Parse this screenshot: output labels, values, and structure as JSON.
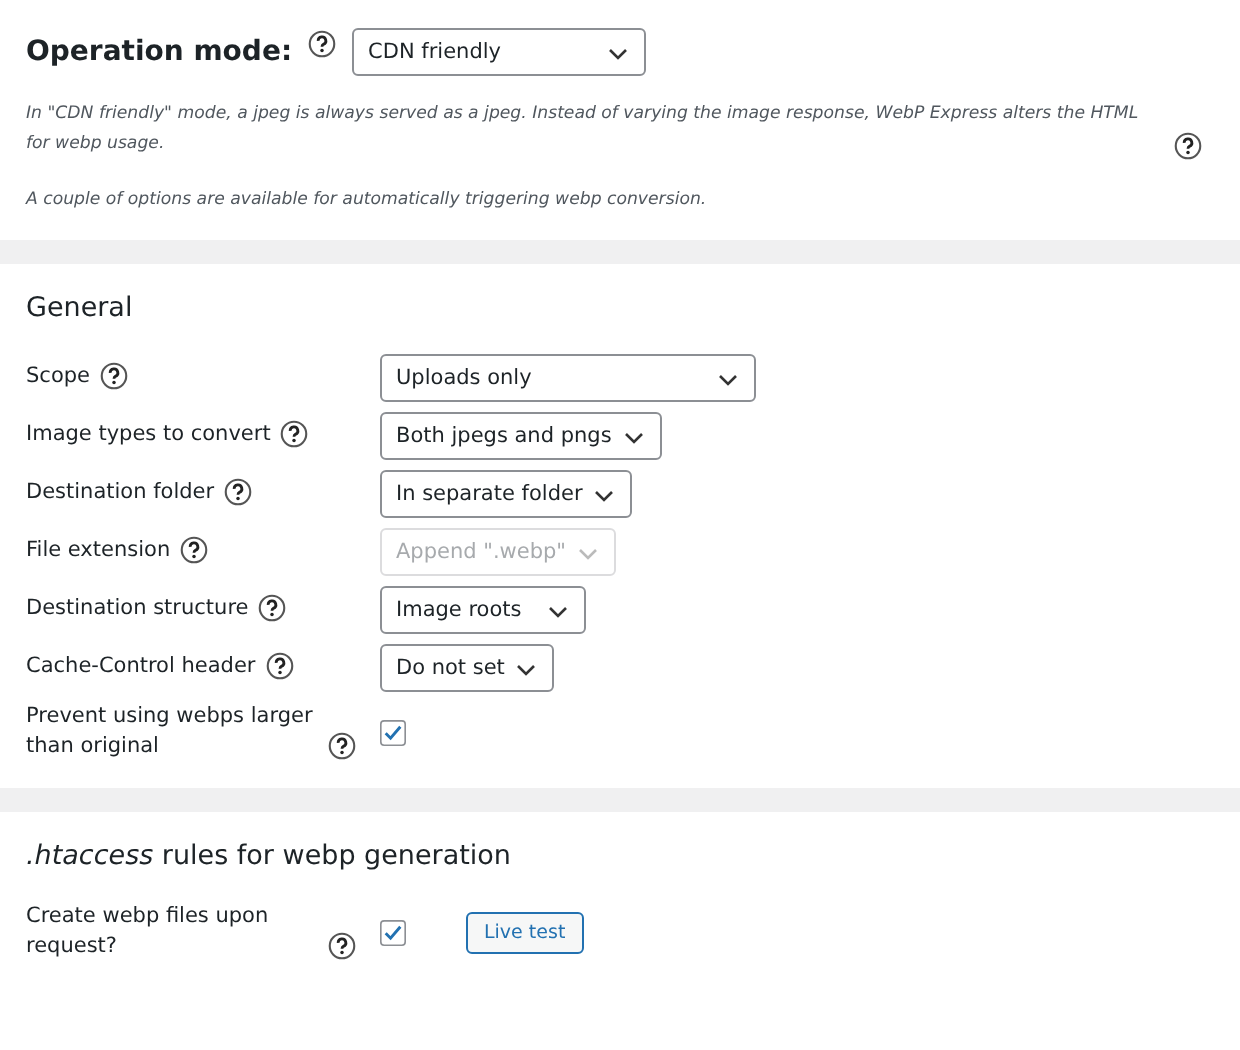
{
  "operation_mode": {
    "label": "Operation mode:",
    "value": "CDN friendly",
    "description": "In \"CDN friendly\" mode, a jpeg is always served as a jpeg. Instead of varying the image response, WebP Express alters the HTML for webp usage.",
    "note": "A couple of options are available for automatically triggering webp conversion."
  },
  "sections": [
    {
      "heading": "General",
      "rows": [
        {
          "kind": "select",
          "label": "Scope",
          "value": "Uploads only",
          "disabled": false
        },
        {
          "kind": "select",
          "label": "Image types to convert",
          "value": "Both jpegs and pngs",
          "disabled": false
        },
        {
          "kind": "select",
          "label": "Destination folder",
          "value": "In separate folder",
          "disabled": false
        },
        {
          "kind": "select",
          "label": "File extension",
          "value": "Append \".webp\"",
          "disabled": true
        },
        {
          "kind": "select",
          "label": "Destination structure",
          "value": "Image roots",
          "disabled": false
        },
        {
          "kind": "select",
          "label": "Cache-Control header",
          "value": "Do not set",
          "disabled": false
        },
        {
          "kind": "checkbox",
          "label": "Prevent using webps larger than original",
          "checked": true
        }
      ]
    },
    {
      "heading": "*.htaccess* rules for webp generation",
      "rows": [
        {
          "kind": "checkbox",
          "label": "Create webp files upon request?",
          "checked": true,
          "button": "Live test"
        }
      ]
    }
  ]
}
